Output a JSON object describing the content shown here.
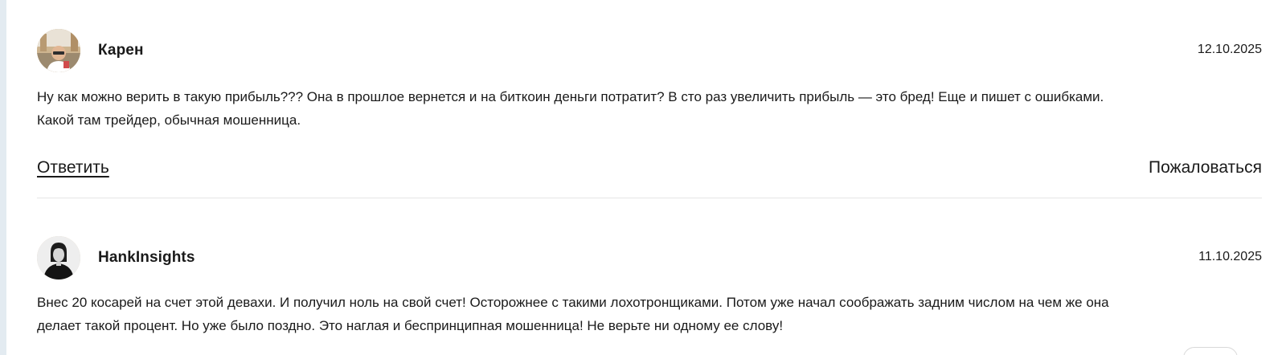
{
  "comments": [
    {
      "author": "Карен",
      "date": "12.10.2025",
      "text_line1": "Ну как можно верить в такую прибыль??? Она в прошлое вернется и на биткоин деньги потратит? В сто раз увеличить прибыль — это бред! Еще и пишет с ошибками.",
      "text_line2": "Какой там трейдер, обычная мошенница.",
      "reply_label": "Ответить",
      "report_label": "Пожаловаться"
    },
    {
      "author": "HankInsights",
      "date": "11.10.2025",
      "text_line1": "Внес 20 косарей на счет этой девахи. И получил ноль на свой счет! Осторожнее с такими лохотронщиками. Потом уже начал соображать задним числом на чем же она",
      "text_line2": "делает такой процент. Но уже было поздно. Это наглая и беспринципная мошенница! Не верьте ни одному ее слову!"
    }
  ]
}
